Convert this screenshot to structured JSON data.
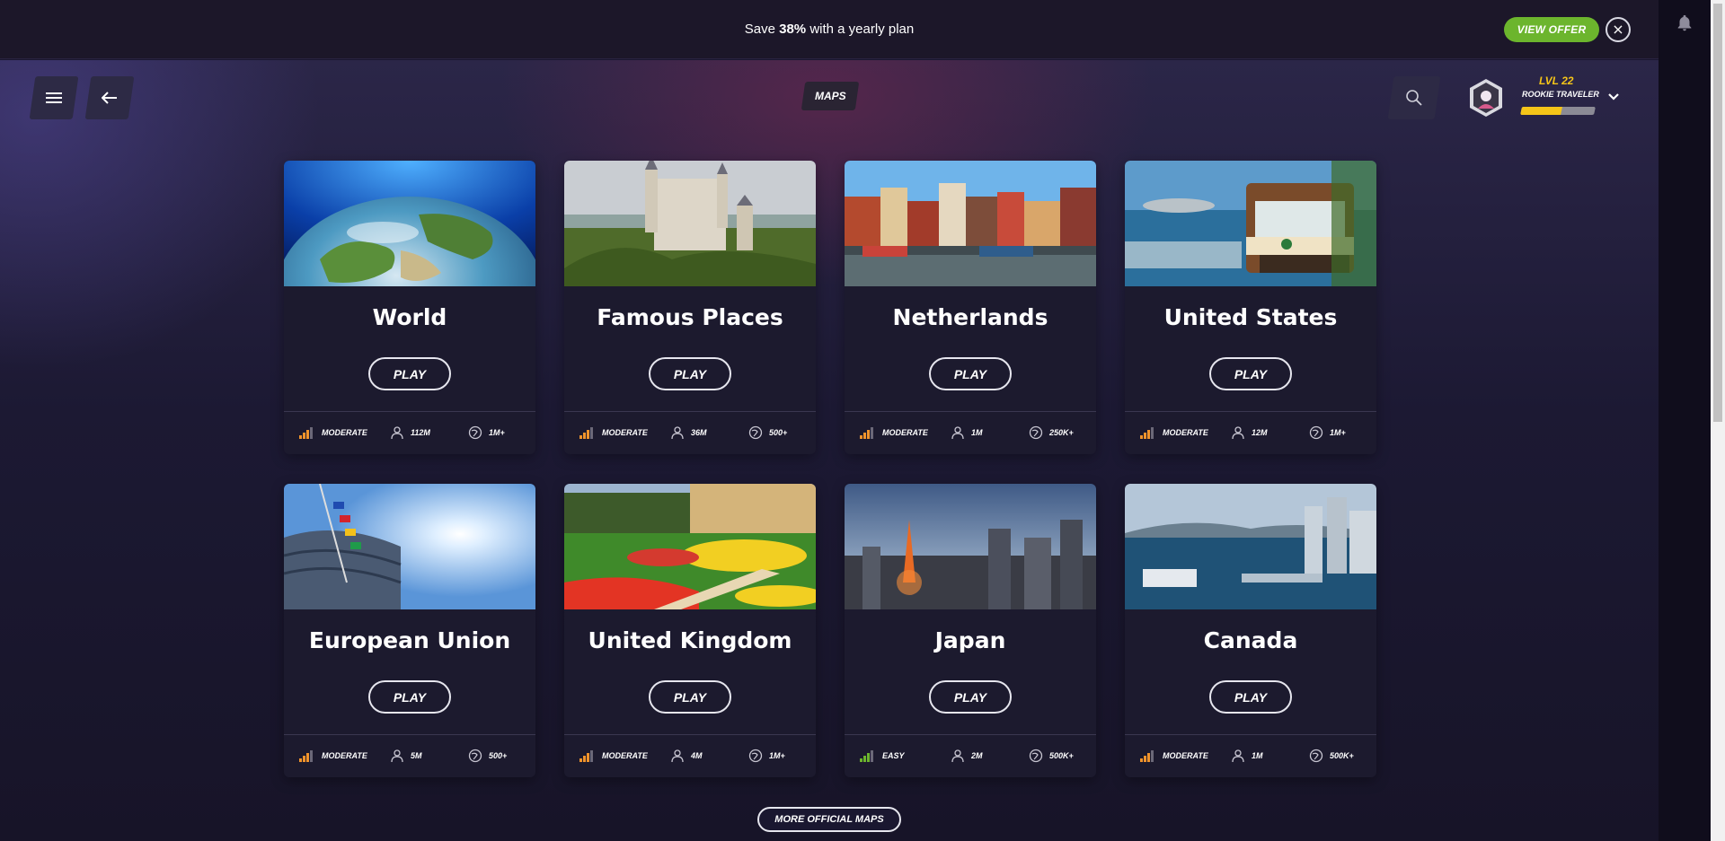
{
  "promo": {
    "text_before": "Save ",
    "highlight": "38%",
    "text_after": " with a yearly plan",
    "offer_label": "VIEW OFFER",
    "close_label": "×"
  },
  "header": {
    "title": "MAPS",
    "level": "LVL 22",
    "rank": "ROOKIE TRAVELER",
    "xp_progress": 0.55
  },
  "cards": [
    {
      "title": "World",
      "play": "PLAY",
      "difficulty": "MODERATE",
      "players": "112M",
      "explorers": "1M+"
    },
    {
      "title": "Famous Places",
      "play": "PLAY",
      "difficulty": "MODERATE",
      "players": "36M",
      "explorers": "500+"
    },
    {
      "title": "Netherlands",
      "play": "PLAY",
      "difficulty": "MODERATE",
      "players": "1M",
      "explorers": "250K+"
    },
    {
      "title": "United States",
      "play": "PLAY",
      "difficulty": "MODERATE",
      "players": "12M",
      "explorers": "1M+"
    },
    {
      "title": "European Union",
      "play": "PLAY",
      "difficulty": "MODERATE",
      "players": "5M",
      "explorers": "500+"
    },
    {
      "title": "United Kingdom",
      "play": "PLAY",
      "difficulty": "MODERATE",
      "players": "4M",
      "explorers": "1M+"
    },
    {
      "title": "Japan",
      "play": "PLAY",
      "difficulty": "EASY",
      "players": "2M",
      "explorers": "500K+"
    },
    {
      "title": "Canada",
      "play": "PLAY",
      "difficulty": "MODERATE",
      "players": "1M",
      "explorers": "500K+"
    }
  ],
  "more_label": "MORE OFFICIAL MAPS",
  "colors": {
    "accent_green": "#6cb52d",
    "level_yellow": "#f5c518",
    "difficulty_moderate": "#f0932b",
    "difficulty_easy": "#6cb52d"
  }
}
